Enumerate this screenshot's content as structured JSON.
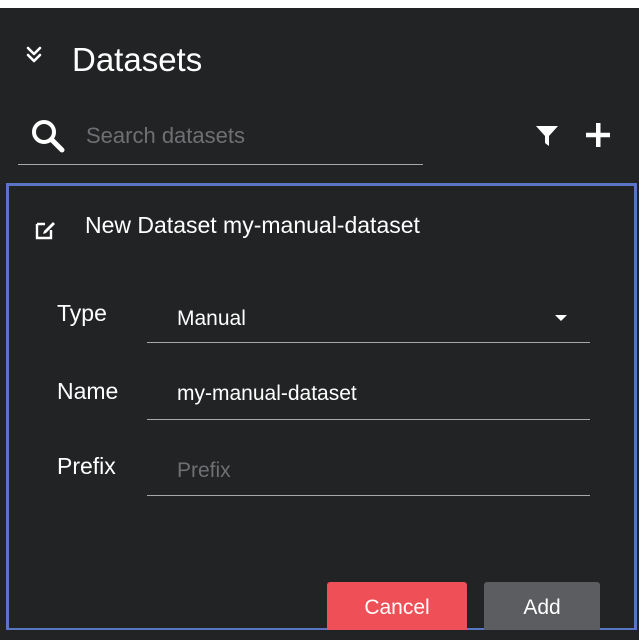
{
  "header": {
    "title": "Datasets",
    "collapse_icon": "double-chevron-down-icon"
  },
  "search": {
    "placeholder": "Search datasets",
    "value": "",
    "icon": "search-icon"
  },
  "toolbar": {
    "filter_icon": "filter-icon",
    "add_icon": "plus-icon"
  },
  "new_dataset_card": {
    "title": "New Dataset my-manual-dataset",
    "edit_icon": "edit-icon",
    "fields": {
      "type": {
        "label": "Type",
        "value": "Manual"
      },
      "name": {
        "label": "Name",
        "value": "my-manual-dataset"
      },
      "prefix": {
        "label": "Prefix",
        "value": "",
        "placeholder": "Prefix"
      }
    },
    "buttons": {
      "cancel": "Cancel",
      "add": "Add"
    }
  },
  "colors": {
    "background": "#222324",
    "card_border": "#5a75c4",
    "cancel": "#ef4f56",
    "add": "#5b5d60",
    "text": "#ffffff",
    "placeholder": "#6e7073",
    "divider": "#a7a8aa"
  }
}
